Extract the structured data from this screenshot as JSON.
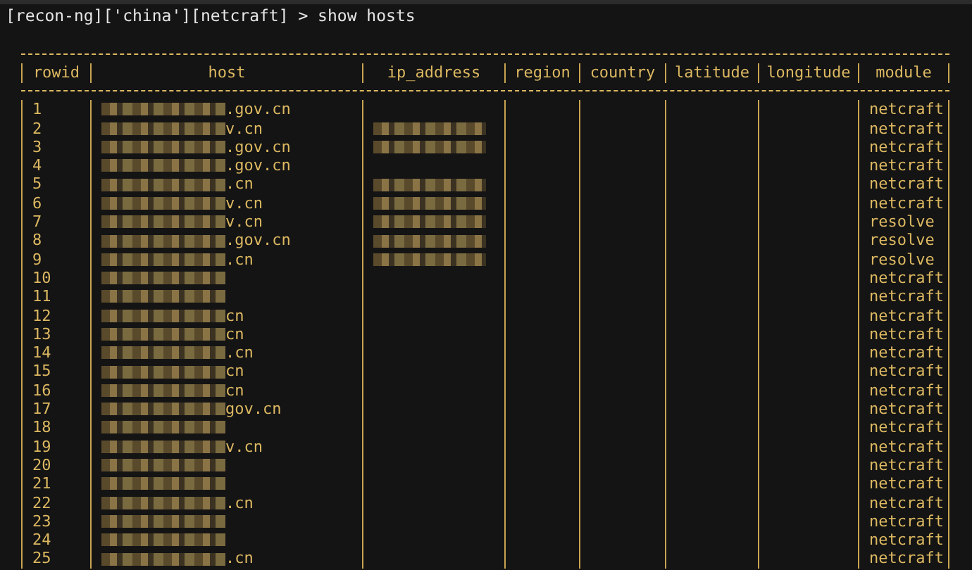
{
  "prompt": "[recon-ng]['china'][netcraft] > show hosts",
  "table": {
    "columns": [
      "rowid",
      "host",
      "ip_address",
      "region",
      "country",
      "latitude",
      "longitude",
      "module"
    ],
    "rows": [
      {
        "rowid": "1",
        "host_redacted": true,
        "host": ".gov.cn",
        "ip_redacted": false,
        "module": "netcraft"
      },
      {
        "rowid": "2",
        "host_redacted": true,
        "host": "v.cn",
        "ip_redacted": true,
        "module": "netcraft"
      },
      {
        "rowid": "3",
        "host_redacted": true,
        "host": ".gov.cn",
        "ip_redacted": true,
        "module": "netcraft"
      },
      {
        "rowid": "4",
        "host_redacted": true,
        "host": ".gov.cn",
        "ip_redacted": false,
        "module": "netcraft"
      },
      {
        "rowid": "5",
        "host_redacted": true,
        "host": ".cn",
        "ip_redacted": true,
        "module": "netcraft"
      },
      {
        "rowid": "6",
        "host_redacted": true,
        "host": "v.cn",
        "ip_redacted": true,
        "module": "netcraft"
      },
      {
        "rowid": "7",
        "host_redacted": true,
        "host": "v.cn",
        "ip_redacted": true,
        "module": "resolve"
      },
      {
        "rowid": "8",
        "host_redacted": true,
        "host": ".gov.cn",
        "ip_redacted": true,
        "module": "resolve"
      },
      {
        "rowid": "9",
        "host_redacted": true,
        "host": ".cn",
        "ip_redacted": true,
        "module": "resolve"
      },
      {
        "rowid": "10",
        "host_redacted": true,
        "ip_redacted": false,
        "module": "netcraft"
      },
      {
        "rowid": "11",
        "host_redacted": true,
        "ip_redacted": false,
        "module": "netcraft"
      },
      {
        "rowid": "12",
        "host_redacted": true,
        "host": "cn",
        "ip_redacted": false,
        "module": "netcraft"
      },
      {
        "rowid": "13",
        "host_redacted": true,
        "host": "cn",
        "ip_redacted": false,
        "module": "netcraft"
      },
      {
        "rowid": "14",
        "host_redacted": true,
        "host": ".cn",
        "ip_redacted": false,
        "module": "netcraft"
      },
      {
        "rowid": "15",
        "host_redacted": true,
        "host": "cn",
        "ip_redacted": false,
        "module": "netcraft"
      },
      {
        "rowid": "16",
        "host_redacted": true,
        "host": "cn",
        "ip_redacted": false,
        "module": "netcraft"
      },
      {
        "rowid": "17",
        "host_redacted": true,
        "host": "gov.cn",
        "ip_redacted": false,
        "module": "netcraft"
      },
      {
        "rowid": "18",
        "host_redacted": true,
        "ip_redacted": false,
        "module": "netcraft"
      },
      {
        "rowid": "19",
        "host_redacted": true,
        "host": "v.cn",
        "ip_redacted": false,
        "module": "netcraft"
      },
      {
        "rowid": "20",
        "host_redacted": true,
        "ip_redacted": false,
        "module": "netcraft"
      },
      {
        "rowid": "21",
        "host_redacted": true,
        "ip_redacted": false,
        "module": "netcraft"
      },
      {
        "rowid": "22",
        "host_redacted": true,
        "host": ".cn",
        "ip_redacted": false,
        "module": "netcraft"
      },
      {
        "rowid": "23",
        "host_redacted": true,
        "ip_redacted": false,
        "module": "netcraft"
      },
      {
        "rowid": "24",
        "host_redacted": true,
        "ip_redacted": false,
        "module": "netcraft"
      },
      {
        "rowid": "25",
        "host_redacted": true,
        "host": ".cn",
        "ip_redacted": false,
        "module": "netcraft"
      }
    ]
  }
}
